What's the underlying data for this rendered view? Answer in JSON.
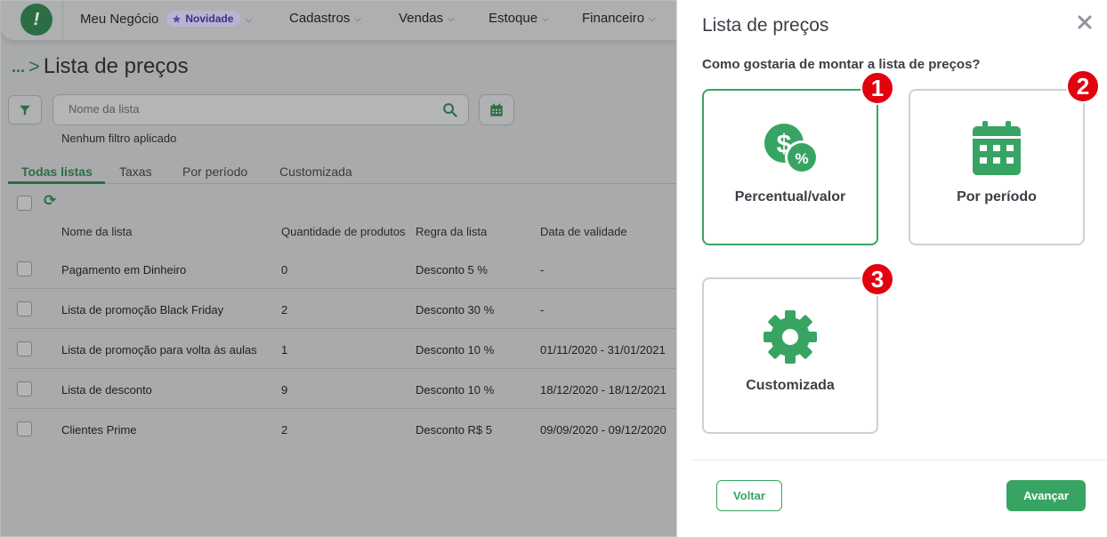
{
  "topbar": {
    "logo": "!",
    "nav": [
      {
        "label": "Meu Negócio",
        "badge": "Novidade"
      },
      {
        "label": "Cadastros"
      },
      {
        "label": "Vendas"
      },
      {
        "label": "Estoque"
      },
      {
        "label": "Financeiro"
      }
    ]
  },
  "page": {
    "breadcrumb_dots": "...",
    "title": "Lista de preços",
    "search_placeholder": "Nome da lista",
    "filter_status": "Nenhum filtro aplicado",
    "tabs": [
      "Todas listas",
      "Taxas",
      "Por período",
      "Customizada"
    ],
    "active_tab": 0,
    "columns": [
      "Nome da lista",
      "Quantidade de produtos",
      "Regra da lista",
      "Data de validade"
    ],
    "rows": [
      {
        "name": "Pagamento em Dinheiro",
        "qty": "0",
        "rule": "Desconto 5 %",
        "validity": "-"
      },
      {
        "name": "Lista de promoção Black Friday",
        "qty": "2",
        "rule": "Desconto 30 %",
        "validity": "-"
      },
      {
        "name": "Lista de promoção para volta às aulas",
        "qty": "1",
        "rule": "Desconto 10 %",
        "validity": "01/11/2020 - 31/01/2021"
      },
      {
        "name": "Lista de desconto",
        "qty": "9",
        "rule": "Desconto 10 %",
        "validity": "18/12/2020 - 18/12/2021"
      },
      {
        "name": "Clientes Prime",
        "qty": "2",
        "rule": "Desconto R$ 5",
        "validity": "09/09/2020 - 09/12/2020"
      }
    ]
  },
  "dialog": {
    "title": "Lista de preços",
    "question": "Como gostaria de montar a lista de preços?",
    "options": [
      {
        "label": "Percentual/valor",
        "icon": "money-percent-icon",
        "marker": "1",
        "selected": true
      },
      {
        "label": "Por período",
        "icon": "calendar-icon",
        "marker": "2",
        "selected": false
      },
      {
        "label": "Customizada",
        "icon": "gear-icon",
        "marker": "3",
        "selected": false
      }
    ],
    "back_label": "Voltar",
    "next_label": "Avançar"
  },
  "colors": {
    "accent": "#38a463",
    "marker": "#e3000f",
    "text_dark": "#3b3f45"
  }
}
